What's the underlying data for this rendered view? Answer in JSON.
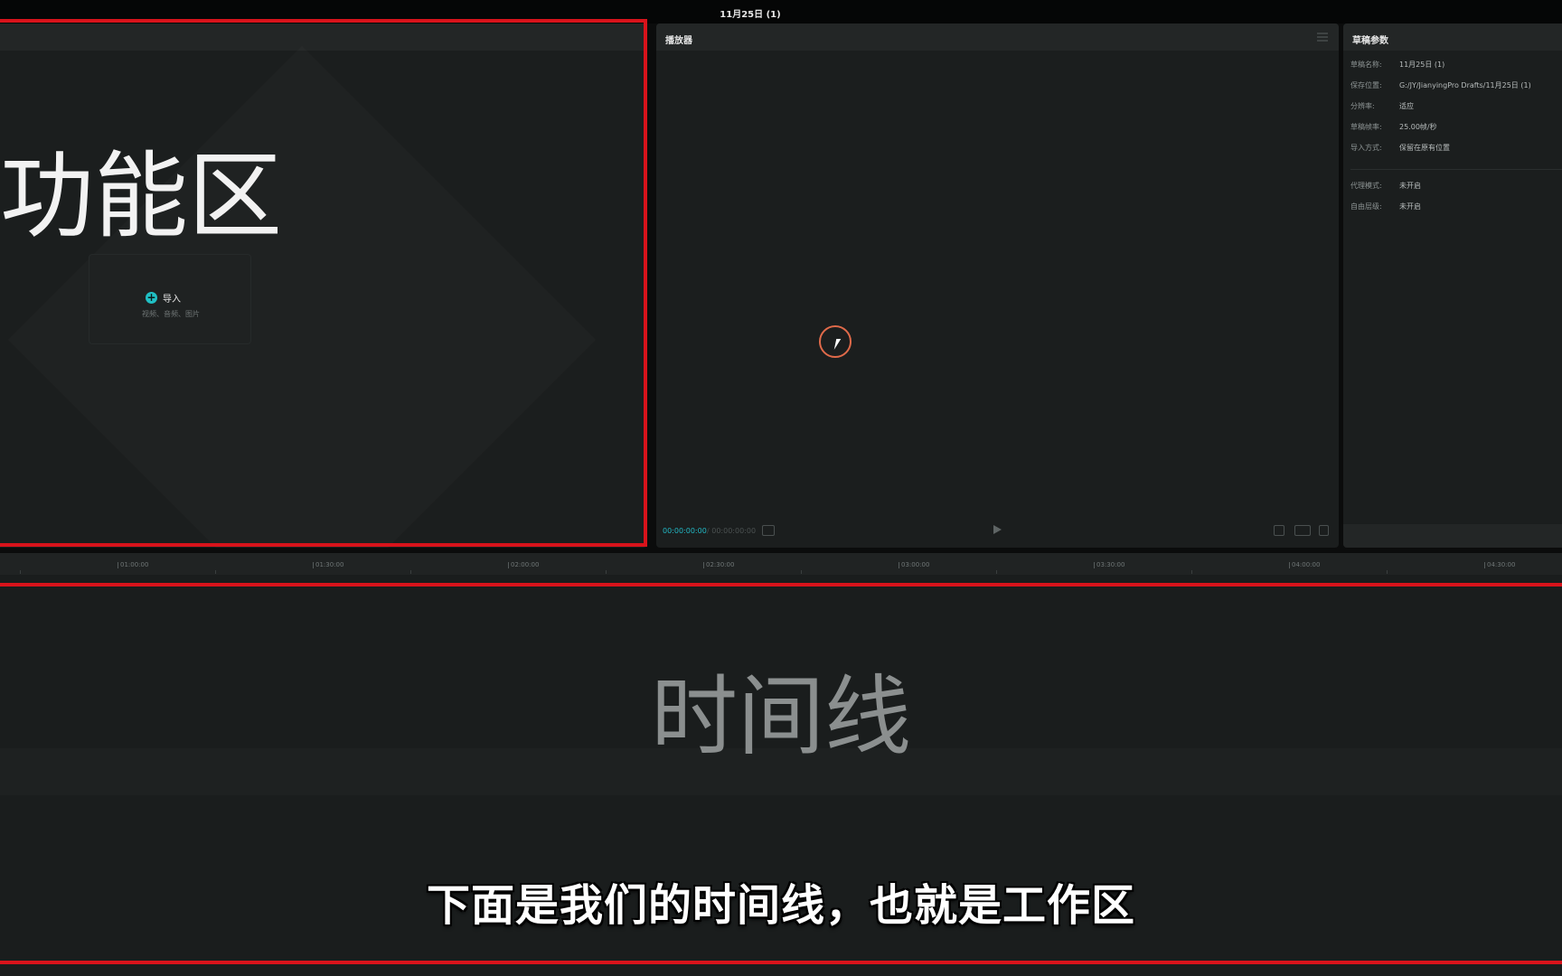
{
  "window": {
    "title": "11月25日 (1)"
  },
  "media_panel": {
    "overlay_label": "功能区",
    "import": {
      "label": "导入",
      "hint": "视频、音频、图片"
    }
  },
  "player": {
    "title": "播放器",
    "time_current": "00:00:00:00",
    "time_total": "/ 00:00:00:00"
  },
  "draft_params": {
    "title": "草稿参数",
    "rows": [
      {
        "key": "草稿名称:",
        "value": "11月25日 (1)"
      },
      {
        "key": "保存位置:",
        "value": "G:/JY/JianyingPro Drafts/11月25日 (1)"
      },
      {
        "key": "分辨率:",
        "value": "适应"
      },
      {
        "key": "草稿帧率:",
        "value": "25.00帧/秒"
      },
      {
        "key": "导入方式:",
        "value": "保留在原有位置"
      },
      {
        "key": "代理模式:",
        "value": "未开启"
      },
      {
        "key": "自由层级:",
        "value": "未开启"
      }
    ]
  },
  "timeline": {
    "overlay_label": "时间线",
    "ruler_ticks": [
      "01:00:00",
      "01:30:00",
      "02:00:00",
      "02:30:00",
      "03:00:00",
      "03:30:00",
      "04:00:00",
      "04:30:00"
    ]
  },
  "subtitle": "下面是我们的时间线，也就是工作区",
  "colors": {
    "accent": "#20c0c4",
    "highlight_frame": "#d8131b",
    "cursor_ring": "#e06a4a"
  }
}
